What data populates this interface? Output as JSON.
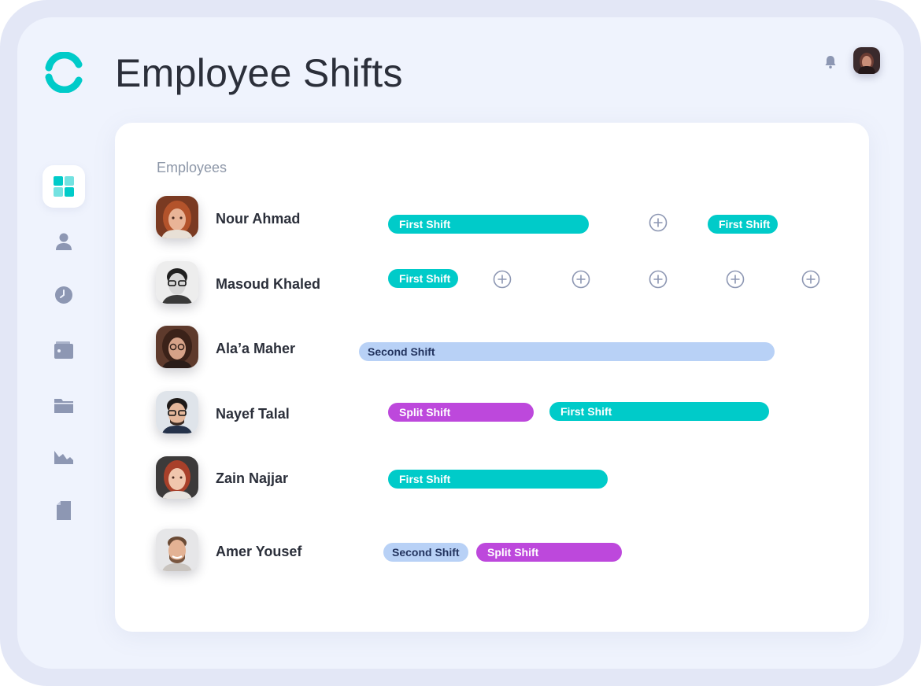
{
  "header": {
    "title": "Employee Shifts",
    "logo_icon": "brand-logo-icon",
    "notification_icon": "bell-icon",
    "accent_color": "#00cbc9"
  },
  "sidebar": {
    "items": [
      {
        "icon": "dashboard-icon",
        "active": true
      },
      {
        "icon": "user-icon"
      },
      {
        "icon": "clock-icon"
      },
      {
        "icon": "wallet-icon"
      },
      {
        "icon": "folder-icon"
      },
      {
        "icon": "chart-icon"
      },
      {
        "icon": "document-icon"
      }
    ]
  },
  "main": {
    "section_label": "Employees",
    "employees": [
      {
        "name": "Nour Ahmad"
      },
      {
        "name": "Masoud Khaled"
      },
      {
        "name": "Ala’a Maher"
      },
      {
        "name": "Nayef Talal"
      },
      {
        "name": "Zain Najjar"
      },
      {
        "name": "Amer Yousef"
      }
    ],
    "shifts": {
      "nour_1": "First Shift",
      "nour_2": "First Shift",
      "masoud_1": "First Shift",
      "alaa_1": "Second Shift",
      "nayef_1": "Split Shift",
      "nayef_2": "First Shift",
      "zain_1": "First Shift",
      "amer_1": "Second Shift",
      "amer_2": "Split Shift"
    },
    "shift_colors": {
      "First Shift": "#00cbc9",
      "Second Shift": "#b8d1f6",
      "Split Shift": "#bd48dc"
    }
  }
}
